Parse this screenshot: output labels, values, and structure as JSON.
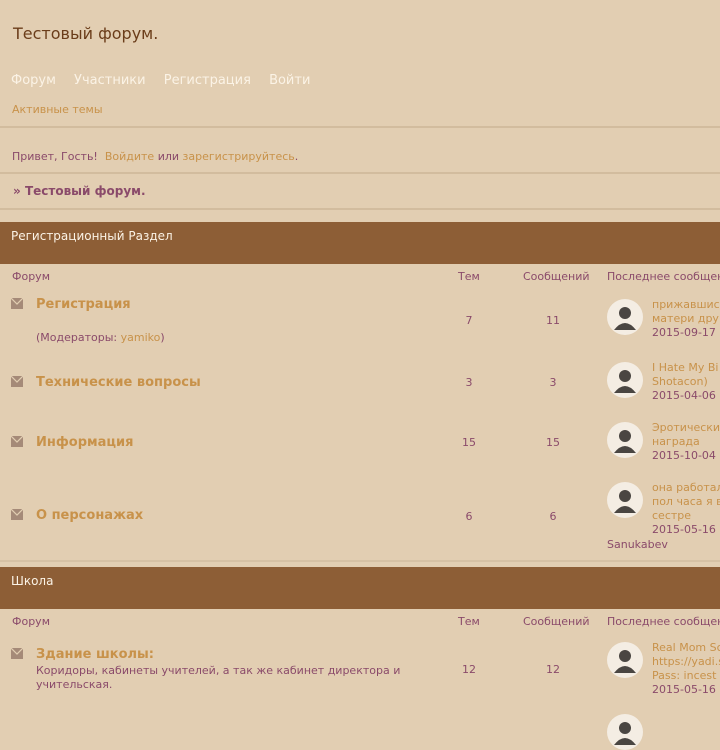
{
  "site": {
    "title": "Тестовый форум."
  },
  "nav": {
    "forum": "Форум",
    "members": "Участники",
    "register": "Регистрация",
    "login": "Войти"
  },
  "active_topics": "Активные темы",
  "greeting": {
    "hello": "Привет, Гость!",
    "login_link": "Войдите",
    "or": "или",
    "register_link": "зарегистрируйтесь",
    "dot": "."
  },
  "breadcrumb": {
    "arrow": "»",
    "title": "Тестовый форум."
  },
  "columns": {
    "forum": "Форум",
    "topics": "Тем",
    "posts": "Сообщений",
    "last": "Последнее сообщение"
  },
  "categories": [
    {
      "title": "Регистрационный Раздел",
      "forums": [
        {
          "name": "Регистрация",
          "moderators_prefix": "(Модераторы: ",
          "moderator": "yamiko",
          "moderators_suffix": ")",
          "topics": "7",
          "posts": "11",
          "last_title_1": "прижавшис",
          "last_title_2": "матери дру",
          "last_date": "2015-09-17"
        },
        {
          "name": "Технические вопросы",
          "topics": "3",
          "posts": "3",
          "last_title_1": "I Hate My Bi",
          "last_title_2": "Shotacon)",
          "last_date": "2015-04-06"
        },
        {
          "name": "Информация",
          "topics": "15",
          "posts": "15",
          "last_title_1": "Эротически",
          "last_title_2": "награда",
          "last_date": "2015-10-04"
        },
        {
          "name": "О персонажах",
          "topics": "6",
          "posts": "6",
          "last_title_1": "она работал",
          "last_title_2": "пол часа я в",
          "last_title_3": "сестре",
          "last_date": "2015-05-16",
          "last_author": "Sanukabev"
        }
      ]
    },
    {
      "title": "Школа",
      "forums": [
        {
          "name": "Здание школы:",
          "desc": "Коридоры, кабинеты учителей, а так же кабинет директора и учительская.",
          "topics": "12",
          "posts": "12",
          "last_title_1": "Real Mom Sc",
          "last_title_2": "https://yadi.s",
          "last_title_3": "Pass: incest",
          "last_date": "2015-05-16"
        }
      ]
    }
  ]
}
